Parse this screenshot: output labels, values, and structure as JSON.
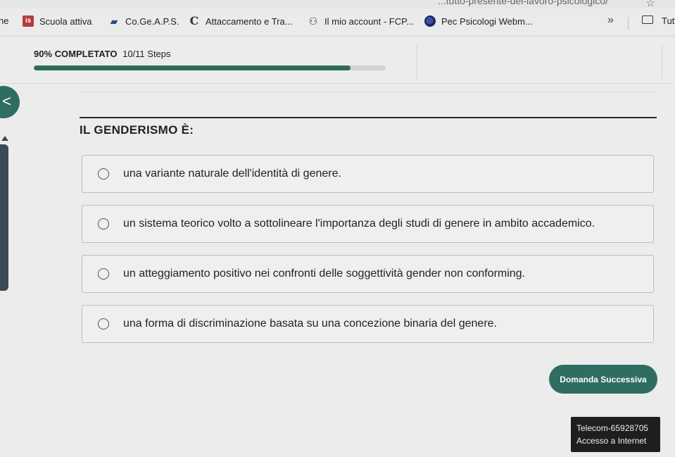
{
  "browser": {
    "url_partial": "...tutto-presente-del-lavoro-psicologico/",
    "bookmarks_cut_left": "he",
    "bookmarks": [
      {
        "label": "Scuola attiva",
        "icon": "is-logo-icon"
      },
      {
        "label": "Co.Ge.A.P.S.",
        "icon": "cogeaps-logo-icon"
      },
      {
        "label": "Attaccamento e Tra...",
        "icon": "c-logo-icon"
      },
      {
        "label": "Il mio account - FCP...",
        "icon": "figures-icon"
      },
      {
        "label": "Pec Psicologi Webm...",
        "icon": "pec-globe-icon"
      }
    ],
    "overflow_chevron": "»",
    "folder_label": "Tutt"
  },
  "progress": {
    "percent_label": "90% COMPLETATO",
    "steps_label": "10/11 Steps",
    "fraction": 0.9
  },
  "nav": {
    "back_glyph": "<"
  },
  "quiz": {
    "question": "IL GENDERISMO È:",
    "options": [
      "una variante naturale dell'identità di genere.",
      "un sistema teorico volto a sottolineare l'importanza degli studi di genere in ambito accademico.",
      "un atteggiamento positivo nei confronti delle soggettività gender non conforming.",
      "una forma di discriminazione basata su una concezione binaria del genere."
    ],
    "next_button": "Domanda Successiva"
  },
  "network": {
    "name": "Telecom-65928705",
    "status": "Accesso a Internet"
  },
  "colors": {
    "accent": "#2f6d63",
    "progress_fill": "#2e6b5c",
    "background": "#ececec"
  }
}
